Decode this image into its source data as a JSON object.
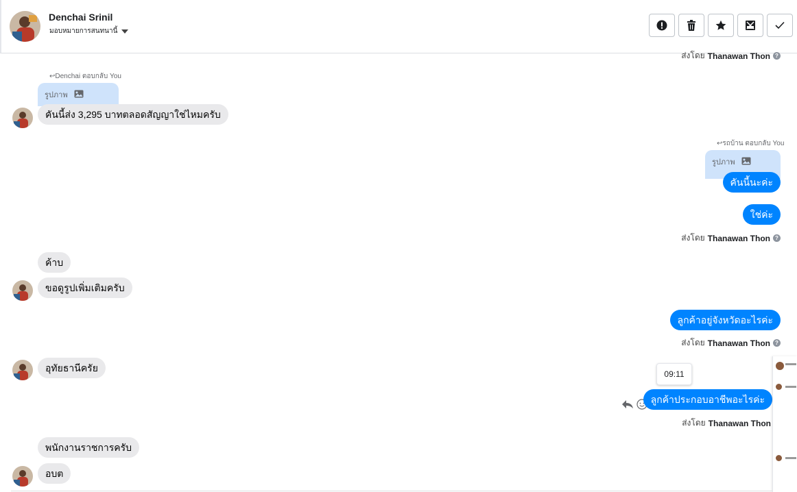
{
  "header": {
    "contact_name": "Denchai Srinil",
    "assign_label": "มอบหมายการสนทนานี้"
  },
  "toolbar": {
    "buttons": [
      "report-icon",
      "trash-icon",
      "star-icon",
      "archive-icon",
      "check-icon"
    ]
  },
  "thread": {
    "top_sent_by_prefix": "ส่งโดย",
    "top_sent_by_name": "Thanawan Thon",
    "reply1_label": "Denchai ตอบกลับ You",
    "reply1_quote": "รูปภาพ",
    "msg1": "คันนี้ส่ง 3,295 บาทตลอดสัญญาใช่ไหมครับ",
    "reply2_label": "รถบ้าน ตอบกลับ You",
    "reply2_quote": "รูปภาพ",
    "msg2": "คันนี้นะค่ะ",
    "msg3": "ใช่ค่ะ",
    "sent_by_prefix": "ส่งโดย",
    "sent_by_name": "Thanawan Thon",
    "msg4": "ค้าบ",
    "msg5": "ขอดูรูปเพิ่มเติมครับ",
    "msg6": "ลูกค้าอยู่จังหวัดอะไรค่ะ",
    "msg7": "อุทัยธานีครัย",
    "tooltip_time": "09:11",
    "msg8": "ลูกค้าประกอบอาชีพอะไรค่ะ",
    "msg9": "พนักงานราชการครับ",
    "msg10": "อบต"
  },
  "colors": {
    "outgoing": "#0084ff",
    "incoming": "#e9e9eb",
    "reply_quote_bg": "#cfe3fb"
  }
}
